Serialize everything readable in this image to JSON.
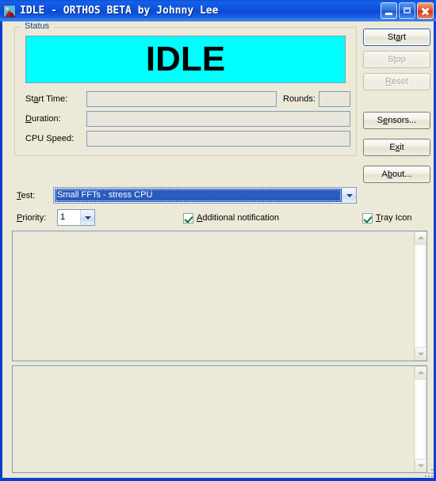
{
  "window": {
    "title": "IDLE - ORTHOS BETA by Johnny Lee",
    "icon": "picture-icon",
    "controls": {
      "minimize": "minimize-icon",
      "maximize": "maximize-icon",
      "close": "close-icon"
    }
  },
  "status_group": {
    "legend": "Status",
    "display_text": "IDLE",
    "display_bg": "#00ffff",
    "display_fg": "#000000",
    "fields": [
      {
        "label": "Start Time:",
        "mnemonic": "a",
        "value": ""
      },
      {
        "label": "Rounds:",
        "mnemonic": "",
        "value": ""
      },
      {
        "label": "Duration:",
        "mnemonic": "D",
        "value": ""
      },
      {
        "label": "CPU Speed:",
        "mnemonic": "",
        "value": ""
      }
    ]
  },
  "labels": {
    "start_time": "Start Time:",
    "rounds": "Rounds:",
    "duration": "Duration:",
    "cpu_speed": "CPU Speed:",
    "test": "Test:",
    "priority": "Priority:"
  },
  "test_combo": {
    "value": "Small FFTs - stress CPU",
    "selected": true
  },
  "priority_combo": {
    "value": "1"
  },
  "checkboxes": {
    "additional_notification": {
      "label": "Additional notification",
      "checked": true
    },
    "tray_icon": {
      "label": "Tray Icon",
      "checked": true
    }
  },
  "buttons": [
    {
      "label": "Start",
      "enabled": true,
      "default": true
    },
    {
      "label": "Stop",
      "enabled": false,
      "default": false
    },
    {
      "label": "Reset",
      "enabled": false,
      "default": false
    },
    {
      "label": "Sensors...",
      "enabled": true,
      "default": false
    },
    {
      "label": "Exit",
      "enabled": true,
      "default": false
    },
    {
      "label": "About...",
      "enabled": true,
      "default": false
    }
  ],
  "log_panels": {
    "upper": {
      "text": ""
    },
    "lower": {
      "text": ""
    }
  },
  "colors": {
    "dialog_bg": "#ece9d8",
    "titlebar_blue": "#0a4fd8",
    "accent_cyan": "#00ffff",
    "legend_blue": "#15428b",
    "field_border": "#7f9db9"
  }
}
